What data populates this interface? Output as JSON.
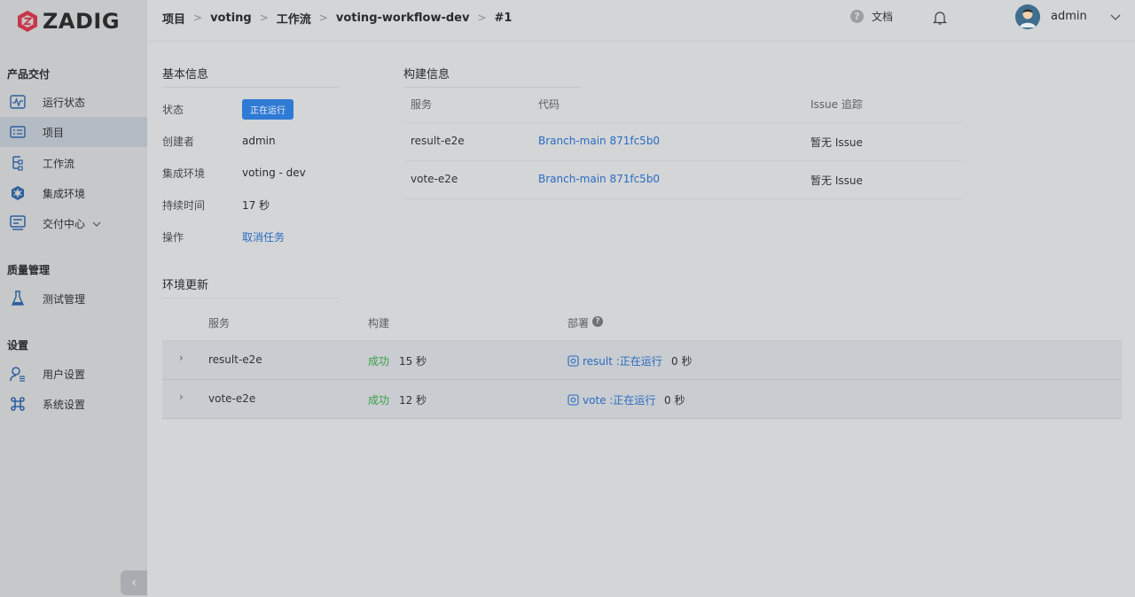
{
  "brand": {
    "name": "ZADIG"
  },
  "sidebar": {
    "groups": [
      {
        "title": "产品交付",
        "items": [
          {
            "label": "运行状态",
            "icon": "pulse-monitor-icon"
          },
          {
            "label": "项目",
            "icon": "project-list-icon"
          },
          {
            "label": "工作流",
            "icon": "workflow-tree-icon"
          },
          {
            "label": "集成环境",
            "icon": "cluster-env-icon"
          },
          {
            "label": "交付中心",
            "icon": "delivery-center-icon"
          }
        ]
      },
      {
        "title": "质量管理",
        "items": [
          {
            "label": "测试管理",
            "icon": "flask-icon"
          }
        ]
      },
      {
        "title": "设置",
        "items": [
          {
            "label": "用户设置",
            "icon": "user-settings-icon"
          },
          {
            "label": "系统设置",
            "icon": "command-icon"
          }
        ]
      }
    ],
    "active_item": "项目",
    "collapse_glyph": "‹"
  },
  "header": {
    "breadcrumb": [
      "项目",
      "voting",
      "工作流",
      "voting-workflow-dev",
      "#1"
    ],
    "breadcrumb_sep": ">",
    "doc_label": "文档",
    "help_glyph": "?",
    "user": "admin"
  },
  "basic_info": {
    "title": "基本信息",
    "status_label": "状态",
    "status_value": "正在运行",
    "creator_label": "创建者",
    "creator_value": "admin",
    "env_label": "集成环境",
    "env_value": "voting - dev",
    "duration_label": "持续时间",
    "duration_value": "17 秒",
    "action_label": "操作",
    "action_value": "取消任务"
  },
  "build_info": {
    "title": "构建信息",
    "columns": [
      "服务",
      "代码",
      "Issue 追踪"
    ],
    "rows": [
      {
        "service": "result-e2e",
        "code": "Branch-main 871fc5b0",
        "issue": "暂无 Issue"
      },
      {
        "service": "vote-e2e",
        "code": "Branch-main 871fc5b0",
        "issue": "暂无 Issue"
      }
    ]
  },
  "env_update": {
    "title": "环境更新",
    "columns": [
      "服务",
      "构建",
      "部署"
    ],
    "help_glyph": "?",
    "expand_glyph": "›",
    "rows": [
      {
        "service": "result-e2e",
        "build_status": "成功",
        "build_time": "15 秒",
        "deploy": "result :正在运行",
        "deploy_time": "0 秒"
      },
      {
        "service": "vote-e2e",
        "build_status": "成功",
        "build_time": "12 秒",
        "deploy": "vote :正在运行",
        "deploy_time": "0 秒"
      }
    ]
  },
  "colors": {
    "accent": "#2f7ad4",
    "link": "#2a6cc2",
    "success": "#3aa14a",
    "logo_red": "#c9354a"
  }
}
